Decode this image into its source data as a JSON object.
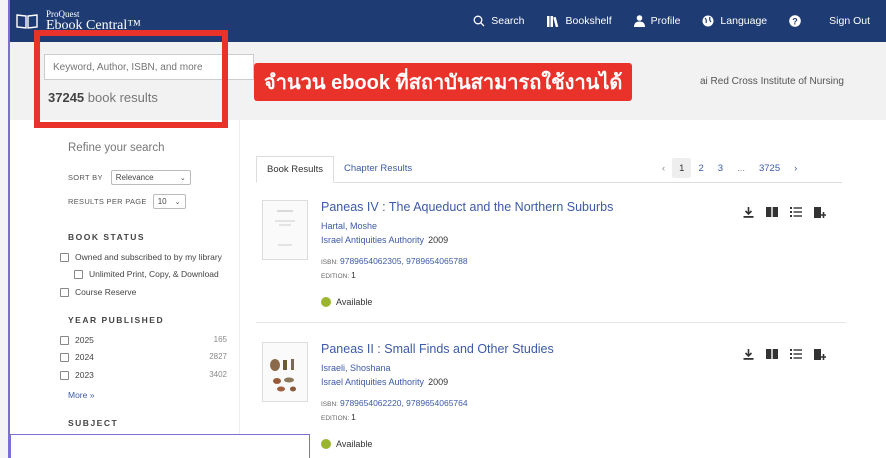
{
  "app": {
    "logo_small": "ProQuest",
    "logo_big": "Ebook Central™"
  },
  "nav": {
    "search": "Search",
    "bookshelf": "Bookshelf",
    "profile": "Profile",
    "language": "Language",
    "signout": "Sign Out"
  },
  "search": {
    "placeholder": "Keyword, Author, ISBN, and more",
    "count": "37245",
    "count_suffix": " book results"
  },
  "institution": "ai Red Cross Institute of Nursing",
  "callout": "จำนวน ebook ที่สถาบันสามารถใช้งานได้",
  "sidebar": {
    "refine": "Refine your search",
    "sort_label": "SORT BY",
    "sort_value": "Relevance",
    "perpage_label": "RESULTS PER PAGE",
    "perpage_value": "10",
    "book_status": "BOOK STATUS",
    "status_options": [
      "Owned and subscribed to by my library",
      "Unlimited Print, Copy, & Download",
      "Course Reserve"
    ],
    "year_head": "YEAR PUBLISHED",
    "years": [
      {
        "label": "2025",
        "count": "165"
      },
      {
        "label": "2024",
        "count": "2827"
      },
      {
        "label": "2023",
        "count": "3402"
      }
    ],
    "more": "More »",
    "subject_head": "SUBJECT"
  },
  "tabs": [
    "Book Results",
    "Chapter Results"
  ],
  "pager": {
    "prev": "‹",
    "pages": [
      "1",
      "2",
      "3"
    ],
    "ellipsis": "...",
    "last": "3725",
    "next": "›"
  },
  "results": [
    {
      "title": "Paneas IV : The Aqueduct and the Northern Suburbs",
      "author": "Hartal, Moshe",
      "publisher": "Israel Antiquities Authority",
      "year": "2009",
      "isbn_label": "ISBN:",
      "isbn": "9789654062305, 9789654065788",
      "edition_label": "EDITION:",
      "edition": "1",
      "availability": "Available"
    },
    {
      "title": "Paneas II : Small Finds and Other Studies",
      "author": "Israeli, Shoshana",
      "publisher": "Israel Antiquities Authority",
      "year": "2009",
      "isbn_label": "ISBN:",
      "isbn": "9789654062220, 9789654065764",
      "edition_label": "EDITION:",
      "edition": "1",
      "availability": "Available"
    }
  ],
  "colors": {
    "topbar": "#1f3b73",
    "accent_red": "#e8322a",
    "link": "#3d5aa8",
    "available": "#9cb52e"
  }
}
